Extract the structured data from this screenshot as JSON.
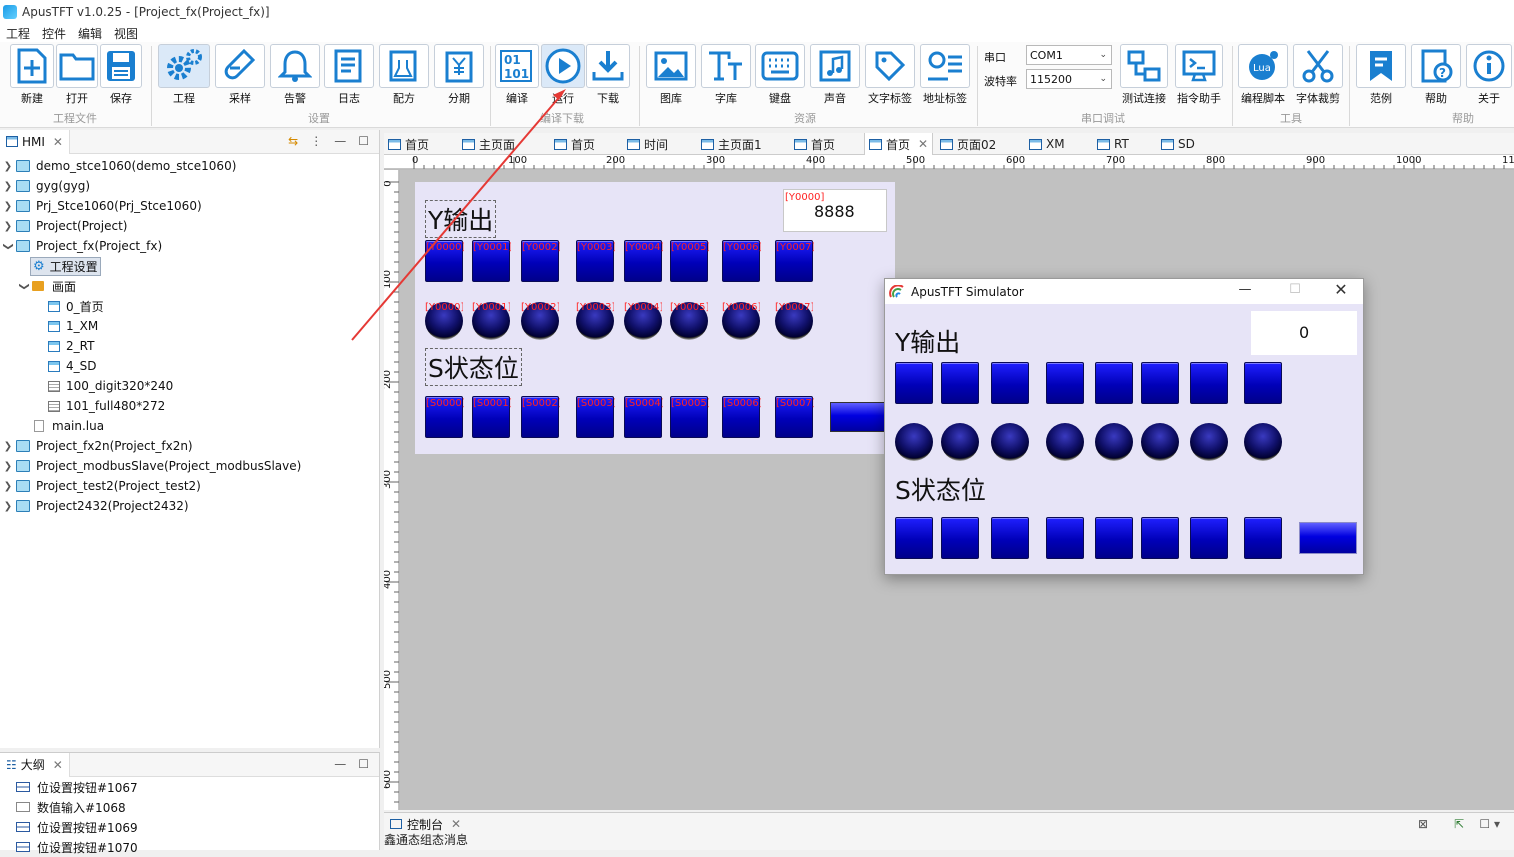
{
  "window": {
    "title": "ApusTFT v1.0.25 - [Project_fx(Project_fx)]"
  },
  "menu": [
    "工程",
    "控件",
    "编辑",
    "视图"
  ],
  "ribbon": {
    "buttons": {
      "new": "新建",
      "open": "打开",
      "save": "保存",
      "project": "工程",
      "sample": "采样",
      "alarm": "告警",
      "log": "日志",
      "recipe": "配方",
      "installment": "分期",
      "compile": "编译",
      "run": "运行",
      "download": "下载",
      "gallery": "图库",
      "fontlib": "字库",
      "keyboard": "键盘",
      "sound": "声音",
      "textlabel": "文字标签",
      "addrlabel": "地址标签",
      "testconn": "测试连接",
      "cmdhelper": "指令助手",
      "luascript": "编程脚本",
      "fontcrop": "字体裁剪",
      "examples": "范例",
      "help": "帮助",
      "about": "关于"
    },
    "groups": {
      "projfile": "工程文件",
      "settings": "设置",
      "compiledl": "编译下载",
      "resources": "资源",
      "serialdebug": "串口调试",
      "tools": "工具",
      "help": "帮助"
    },
    "serial": {
      "port_label": "串口",
      "port_value": "COM1",
      "baud_label": "波特率",
      "baud_value": "115200"
    }
  },
  "left_panel": {
    "tab": "HMI",
    "tree": [
      "demo_stce1060(demo_stce1060)",
      "gyg(gyg)",
      "Prj_Stce1060(Prj_Stce1060)",
      "Project(Project)",
      "Project_fx(Project_fx)",
      "工程设置",
      "画面",
      "0_首页",
      "1_XM",
      "2_RT",
      "4_SD",
      "100_digit320*240",
      "101_full480*272",
      "main.lua",
      "Project_fx2n(Project_fx2n)",
      "Project_modbusSlave(Project_modbusSlave)",
      "Project_test2(Project_test2)",
      "Project2432(Project2432)"
    ]
  },
  "outline_panel": {
    "tab": "大纲",
    "items": [
      "位设置按钮#1067",
      "数值输入#1068",
      "位设置按钮#1069",
      "位设置按钮#1070"
    ]
  },
  "editor_tabs": [
    "首页",
    "主页面",
    "首页",
    "时间",
    "主页面1",
    "首页",
    "首页",
    "页面02",
    "XM",
    "RT",
    "SD"
  ],
  "ruler": {
    "h": [
      "0",
      "100",
      "200",
      "300",
      "400",
      "500",
      "600",
      "700",
      "800",
      "900",
      "1000",
      "11"
    ],
    "v": [
      "0",
      "100",
      "200",
      "300",
      "400",
      "500",
      "600"
    ]
  },
  "design": {
    "y_title": "Y输出",
    "s_title": "S状态位",
    "num_value": "8888",
    "num_addr": "[Y0000]",
    "y_buttons": [
      "[Y0000]",
      "[Y0001]",
      "[Y0002]",
      "[Y0003]",
      "[Y0004]",
      "[Y0005]",
      "[Y0006]",
      "[Y0007]"
    ],
    "y_lamps": [
      "[Y0000]",
      "[Y0001]",
      "[Y0002]",
      "[Y0003]",
      "[Y0004]",
      "[Y0005]",
      "[Y0006]",
      "[Y0007]"
    ],
    "s_buttons": [
      "[S0000]",
      "[S0001]",
      "[S0002]",
      "[S0003]",
      "[S0004]",
      "[S0005]",
      "[S0006]",
      "[S0007]"
    ]
  },
  "simulator": {
    "title": "ApusTFT Simulator",
    "y_title": "Y输出",
    "s_title": "S状态位",
    "num_value": "0"
  },
  "console": {
    "tab": "控制台",
    "message": "鑫通态组态消息"
  },
  "colors": {
    "button_blue": "#0000d0",
    "address_red": "#ff2222",
    "arrow_red": "#e53935",
    "screen_bg": "#e7e4f7"
  }
}
